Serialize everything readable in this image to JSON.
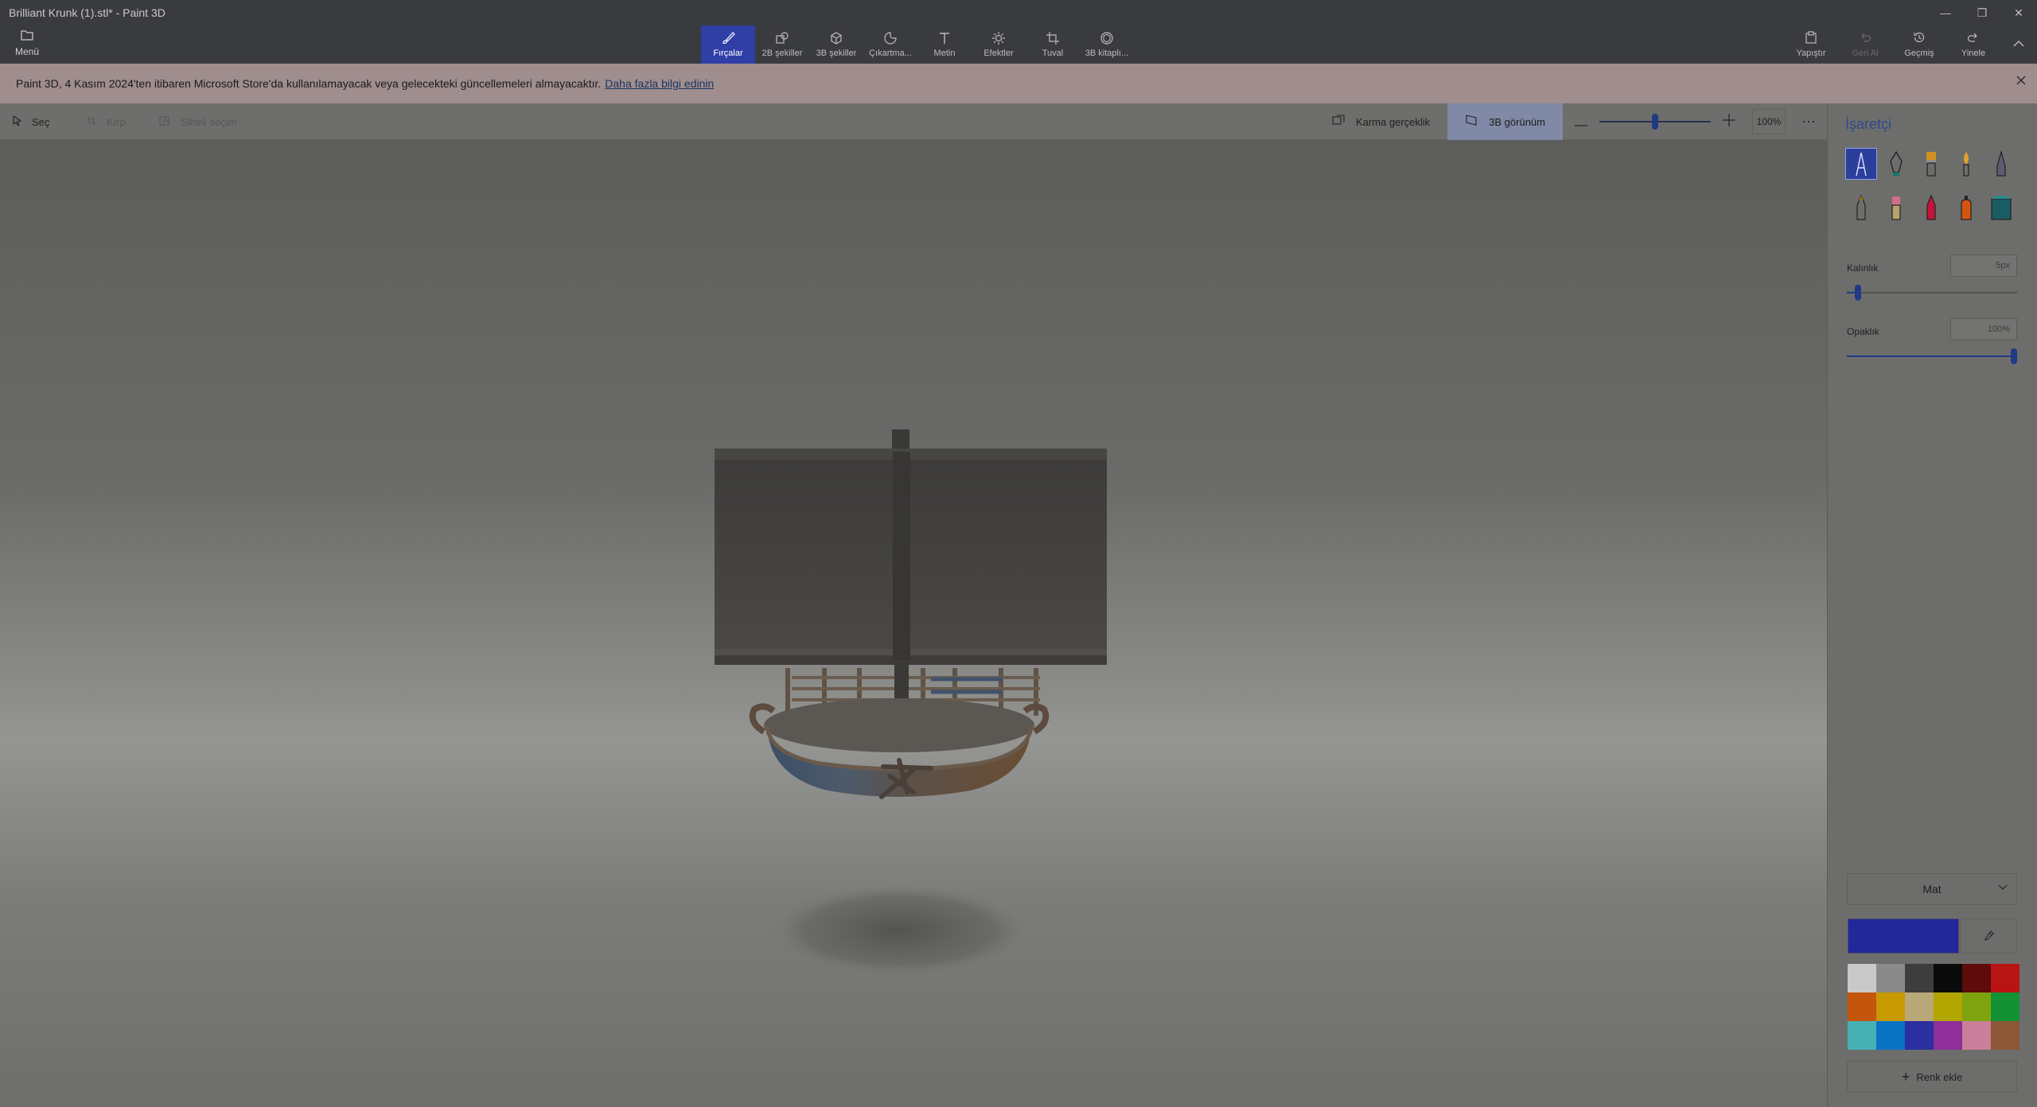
{
  "window": {
    "title": "Brilliant Krunk (1).stl* - Paint 3D",
    "controls": [
      "—",
      "❐",
      "✕"
    ]
  },
  "menu": {
    "label": "Menü",
    "icon": "folder-icon"
  },
  "tools": [
    {
      "label": "Fırçalar",
      "icon": "brush-icon",
      "active": true
    },
    {
      "label": "2B şekiller",
      "icon": "2d-shapes-icon"
    },
    {
      "label": "3B şekiller",
      "icon": "3d-cube-icon"
    },
    {
      "label": "Çıkartma...",
      "icon": "sticker-icon"
    },
    {
      "label": "Metin",
      "icon": "text-icon"
    },
    {
      "label": "Efektler",
      "icon": "sun-icon"
    },
    {
      "label": "Tuval",
      "icon": "crop-icon"
    },
    {
      "label": "3B kitaplı...",
      "icon": "3d-library-icon"
    }
  ],
  "right_tools": [
    {
      "label": "Yapıştır",
      "icon": "paste-icon",
      "enabled": true
    },
    {
      "label": "Geri Al",
      "icon": "undo-icon",
      "enabled": false
    },
    {
      "label": "Geçmiş",
      "icon": "history-icon",
      "enabled": true
    },
    {
      "label": "Yinele",
      "icon": "redo-icon",
      "enabled": true
    }
  ],
  "banner": {
    "text": "Paint 3D, 4 Kasım 2024'ten itibaren Microsoft Store'da kullanılamayacak veya gelecekteki güncellemeleri almayacaktır.",
    "link": "Daha fazla bilgi edinin"
  },
  "selection": {
    "select": "Seç",
    "crop": "Kırp",
    "magic_select": "Sihirli seçim"
  },
  "view": {
    "mixed_reality": "Karma gerçeklik",
    "view_3d": "3B görünüm",
    "zoom": "100%"
  },
  "panel": {
    "title": "İşaretçi",
    "thickness_label": "Kalınlık",
    "thickness_value": "5px",
    "thickness_fraction": 0.05,
    "opacity_label": "Opaklık",
    "opacity_value": "100%",
    "opacity_fraction": 1.0,
    "finish": "Mat",
    "current_color": "#22289a",
    "add_color": "Renk ekle",
    "brushes": [
      {
        "icon": "marker-icon",
        "active": true
      },
      {
        "icon": "calligraphy-pen-icon"
      },
      {
        "icon": "oil-brush-icon"
      },
      {
        "icon": "watercolor-icon"
      },
      {
        "icon": "pixel-pen-icon"
      },
      {
        "icon": "pencil-icon"
      },
      {
        "icon": "eraser-icon"
      },
      {
        "icon": "crayon-icon"
      },
      {
        "icon": "spray-can-icon"
      },
      {
        "icon": "fill-icon"
      }
    ],
    "palette": [
      "#c9c9c9",
      "#8a8a8a",
      "#3d3d3d",
      "#0a0a0a",
      "#5d0b0b",
      "#b81414",
      "#c3550d",
      "#c69a00",
      "#b9a878",
      "#b3a500",
      "#7fa30f",
      "#139135",
      "#46b1b4",
      "#0b73c3",
      "#2b2fa0",
      "#8e2f9a",
      "#c97f9a",
      "#8b5736"
    ]
  }
}
